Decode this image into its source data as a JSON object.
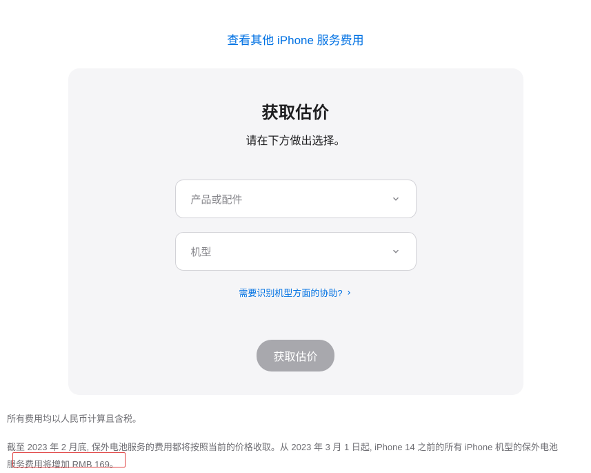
{
  "top_link": "查看其他 iPhone 服务费用",
  "card": {
    "title": "获取估价",
    "subtitle": "请在下方做出选择。",
    "product_placeholder": "产品或配件",
    "model_placeholder": "机型",
    "help_link": "需要识别机型方面的协助?",
    "submit_label": "获取估价"
  },
  "footer": {
    "line1": "所有费用均以人民币计算且含税。",
    "line2": "截至 2023 年 2 月底, 保外电池服务的费用都将按照当前的价格收取。从 2023 年 3 月 1 日起, iPhone 14 之前的所有 iPhone 机型的保外电池服务费用将增加 RMB 169。"
  }
}
